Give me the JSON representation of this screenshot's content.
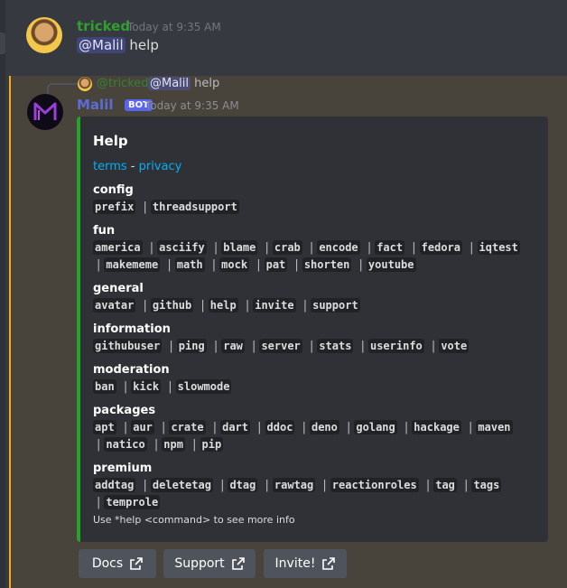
{
  "message1": {
    "author": "tricked",
    "timestamp": "Today at 9:35 AM",
    "mention": "@Malil",
    "text": "help"
  },
  "message2": {
    "reply": {
      "author": "@tricked",
      "mention": "@Malil",
      "text": "help"
    },
    "author": "Malil",
    "bot_tag": "BOT",
    "timestamp": "Today at 9:35 AM",
    "embed": {
      "title": "Help",
      "links": {
        "terms": "terms",
        "separator": "-",
        "privacy": "privacy"
      },
      "fields": [
        {
          "name": "config",
          "values": [
            "prefix",
            "threadsupport"
          ]
        },
        {
          "name": "fun",
          "values": [
            "america",
            "asciify",
            "blame",
            "crab",
            "encode",
            "fact",
            "fedora",
            "iqtest",
            "makememe",
            "math",
            "mock",
            "pat",
            "shorten",
            "youtube"
          ]
        },
        {
          "name": "general",
          "values": [
            "avatar",
            "github",
            "help",
            "invite",
            "support"
          ]
        },
        {
          "name": "information",
          "values": [
            "githubuser",
            "ping",
            "raw",
            "server",
            "stats",
            "userinfo",
            "vote"
          ]
        },
        {
          "name": "moderation",
          "values": [
            "ban",
            "kick",
            "slowmode"
          ]
        },
        {
          "name": "packages",
          "values": [
            "apt",
            "aur",
            "crate",
            "dart",
            "ddoc",
            "deno",
            "golang",
            "hackage",
            "maven",
            "natico",
            "npm",
            "pip"
          ]
        },
        {
          "name": "premium",
          "values": [
            "addtag",
            "deletetag",
            "dtag",
            "rawtag",
            "reactionroles",
            "tag",
            "tags",
            "temprole"
          ]
        }
      ],
      "footer": "Use *help <command> to see more info"
    },
    "buttons": [
      {
        "label": "Docs"
      },
      {
        "label": "Support"
      },
      {
        "label": "Invite!"
      }
    ]
  },
  "colors": {
    "embed_accent": "#23a529",
    "highlight_bar": "#faa81a",
    "bot_tag": "#5865f2",
    "link": "#00aff4"
  }
}
